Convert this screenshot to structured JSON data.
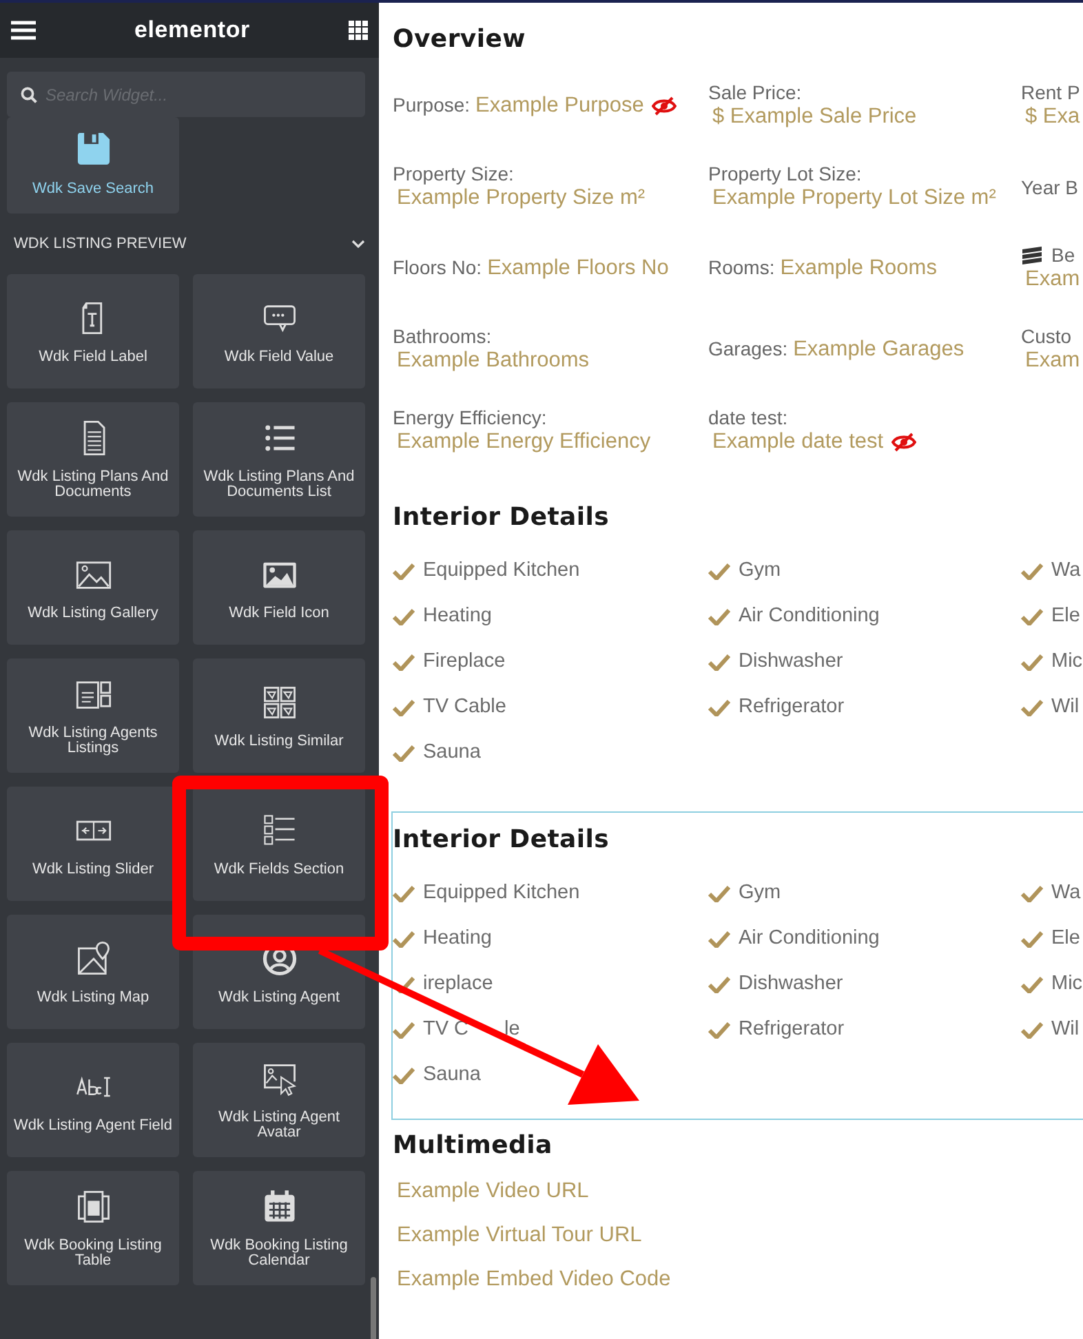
{
  "sidebar": {
    "logo": "elementor",
    "search": {
      "placeholder": "Search Widget..."
    },
    "pinned_widget": {
      "label": "Wdk Save Search",
      "active": true
    },
    "category": {
      "title": "WDK LISTING PREVIEW",
      "expanded": true
    },
    "widgets": [
      {
        "label": "Wdk Field Label"
      },
      {
        "label": "Wdk Field Value"
      },
      {
        "label": "Wdk Listing Plans And Documents"
      },
      {
        "label": "Wdk Listing Plans And Documents List"
      },
      {
        "label": "Wdk Listing Gallery"
      },
      {
        "label": "Wdk Field Icon"
      },
      {
        "label": "Wdk Listing Agents Listings"
      },
      {
        "label": "Wdk Listing Similar"
      },
      {
        "label": "Wdk Listing Slider"
      },
      {
        "label": "Wdk Fields Section"
      },
      {
        "label": "Wdk Listing Map"
      },
      {
        "label": "Wdk Listing Agent"
      },
      {
        "label": "Wdk Listing Agent Field"
      },
      {
        "label": "Wdk Listing Agent Avatar"
      },
      {
        "label": "Wdk Booking Listing Table"
      },
      {
        "label": "Wdk Booking Listing Calendar"
      }
    ]
  },
  "overview": {
    "title": "Overview",
    "rows": [
      [
        {
          "kind": "inline",
          "label": "Purpose:",
          "value": "Example Purpose",
          "hidden": true
        },
        {
          "kind": "stacked",
          "label": "Sale Price:",
          "value": "$ Example Sale Price",
          "hidden": false
        },
        {
          "kind": "stacked",
          "label": "Rent P",
          "value": "$ Exa"
        }
      ],
      [
        {
          "kind": "stacked",
          "label": "Property Size:",
          "value": "Example Property Size m²",
          "hidden": false
        },
        {
          "kind": "stacked",
          "label": "Property Lot Size:",
          "value": "Example Property Lot Size m²",
          "hidden": false
        },
        {
          "kind": "label-only",
          "label": "Year B"
        }
      ],
      [
        {
          "kind": "inline",
          "label": "Floors No:",
          "value": "Example Floors No",
          "hidden": false
        },
        {
          "kind": "inline",
          "label": "Rooms:",
          "value": "Example Rooms",
          "hidden": false
        },
        {
          "kind": "icon-stacked",
          "label": "Be",
          "value": "Exam"
        }
      ],
      [
        {
          "kind": "stacked",
          "label": "Bathrooms:",
          "value": "Example Bathrooms",
          "hidden": false
        },
        {
          "kind": "inline",
          "label": "Garages:",
          "value": "Example Garages",
          "hidden": false
        },
        {
          "kind": "stacked",
          "label": "Custo",
          "value": "Exam"
        }
      ],
      [
        {
          "kind": "stacked",
          "label": "Energy Efficiency:",
          "value": "Example Energy Efficiency",
          "hidden": false
        },
        {
          "kind": "stacked",
          "label": "date test:",
          "value": "Example date test",
          "hidden": true
        }
      ]
    ]
  },
  "amenity_sections": [
    {
      "title": "Interior Details",
      "selected": false,
      "items": [
        "Equipped Kitchen",
        "Gym",
        "Wa",
        "Heating",
        "Air Conditioning",
        "Ele",
        "Fireplace",
        "Dishwasher",
        "Mic",
        "TV Cable",
        "Refrigerator",
        "Wil",
        "Sauna"
      ]
    },
    {
      "title": "Interior Details",
      "selected": true,
      "items": [
        "Equipped Kitchen",
        "Gym",
        "Wa",
        "Heating",
        "Air Conditioning",
        "Ele",
        "ireplace",
        "Dishwasher",
        "Mic",
        [
          "TV C",
          "le"
        ],
        "Refrigerator",
        "Wil",
        "Sauna"
      ]
    }
  ],
  "multimedia": {
    "title": "Multimedia",
    "links": [
      "Example Video URL",
      "Example Virtual Tour URL",
      "Example Embed Video Code"
    ]
  }
}
